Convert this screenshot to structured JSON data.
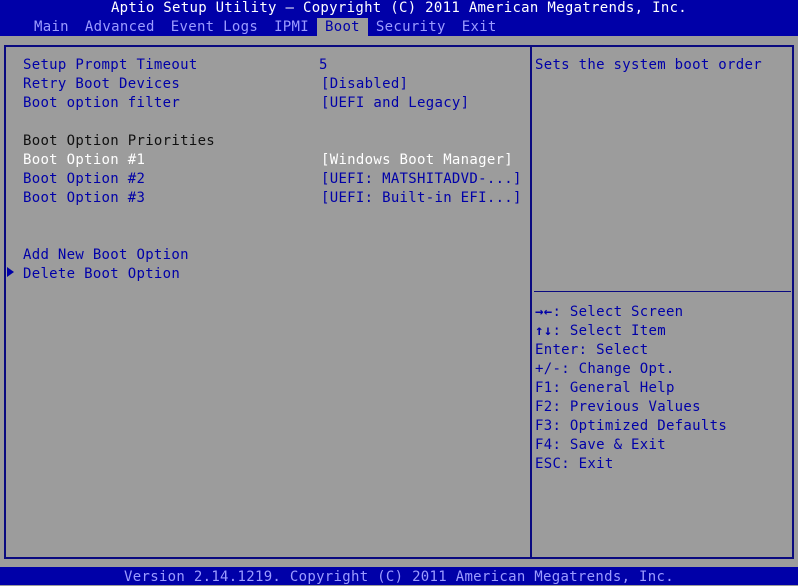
{
  "header": {
    "title": "Aptio Setup Utility – Copyright (C) 2011 American Megatrends, Inc.",
    "tabs": [
      {
        "label": "Main",
        "active": false
      },
      {
        "label": "Advanced",
        "active": false
      },
      {
        "label": "Event Logs",
        "active": false
      },
      {
        "label": "IPMI",
        "active": false
      },
      {
        "label": "Boot",
        "active": true
      },
      {
        "label": "Security",
        "active": false
      },
      {
        "label": "Exit",
        "active": false
      }
    ]
  },
  "settings": [
    {
      "label": "Setup Prompt Timeout",
      "value": "5"
    },
    {
      "label": "Retry Boot Devices",
      "value": "[Disabled]"
    },
    {
      "label": "Boot option filter",
      "value": "[UEFI and Legacy]"
    }
  ],
  "priorities": {
    "heading": "Boot Option Priorities",
    "options": [
      {
        "label": "Boot Option #1",
        "value": "[Windows Boot Manager]",
        "selected": true
      },
      {
        "label": "Boot Option #2",
        "value": "[UEFI: MATSHITADVD-...]",
        "selected": false
      },
      {
        "label": "Boot Option #3",
        "value": "[UEFI: Built-in EFI...]",
        "selected": false
      }
    ]
  },
  "actions": [
    {
      "label": "Add New Boot Option",
      "submenu": false
    },
    {
      "label": "Delete Boot Option",
      "submenu": true
    }
  ],
  "help": {
    "description": "Sets the system boot order",
    "keys": [
      {
        "key": "→←",
        "desc": ": Select Screen"
      },
      {
        "key": "↑↓",
        "desc": ": Select Item"
      },
      {
        "key": "Enter",
        "desc": ": Select"
      },
      {
        "key": "+/-",
        "desc": ": Change Opt."
      },
      {
        "key": "F1",
        "desc": ": General Help"
      },
      {
        "key": "F2",
        "desc": ": Previous Values"
      },
      {
        "key": "F3",
        "desc": ": Optimized Defaults"
      },
      {
        "key": "F4",
        "desc": ": Save & Exit"
      },
      {
        "key": "ESC",
        "desc": ": Exit"
      }
    ]
  },
  "footer": {
    "text": "Version 2.14.1219. Copyright (C) 2011 American Megatrends, Inc."
  },
  "colors": {
    "bar_blue": "#0000a8",
    "background_grey": "#9c9c9c",
    "text_blue": "#0000a8",
    "selected_white": "#ffffff",
    "inactive_tab": "#9c9cff"
  }
}
